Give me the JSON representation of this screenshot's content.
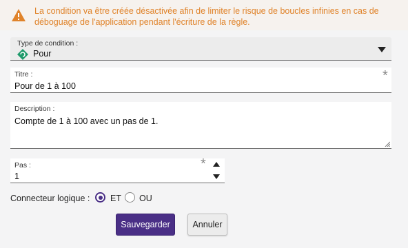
{
  "warning": {
    "line1": "La condition va être créée désactivée afin de limiter le risque de boucles infinies en cas de",
    "line2": "déboguage de l'application pendant l'écriture de la règle.",
    "color": "#e0832a",
    "icon": "warning-triangle-icon"
  },
  "form": {
    "type": {
      "label": "Type de condition :",
      "value": "Pour",
      "icon": "loop-diamond-icon"
    },
    "titre": {
      "label": "Titre :",
      "value": "Pour de 1 à 100",
      "required_mark": "*"
    },
    "description": {
      "label": "Description :",
      "value": "Compte de 1 à 100 avec un pas de 1."
    },
    "pas": {
      "label": "Pas :",
      "value": "1",
      "required_mark": "*"
    },
    "connecteur": {
      "label": "Connecteur logique :",
      "options": [
        {
          "label": "ET",
          "selected": true
        },
        {
          "label": "OU",
          "selected": false
        }
      ]
    }
  },
  "buttons": {
    "save": "Sauvegarder",
    "cancel": "Annuler"
  },
  "colors": {
    "accent": "#4a2f86",
    "warning": "#e0832a",
    "diamond": "#1f9a6b"
  }
}
